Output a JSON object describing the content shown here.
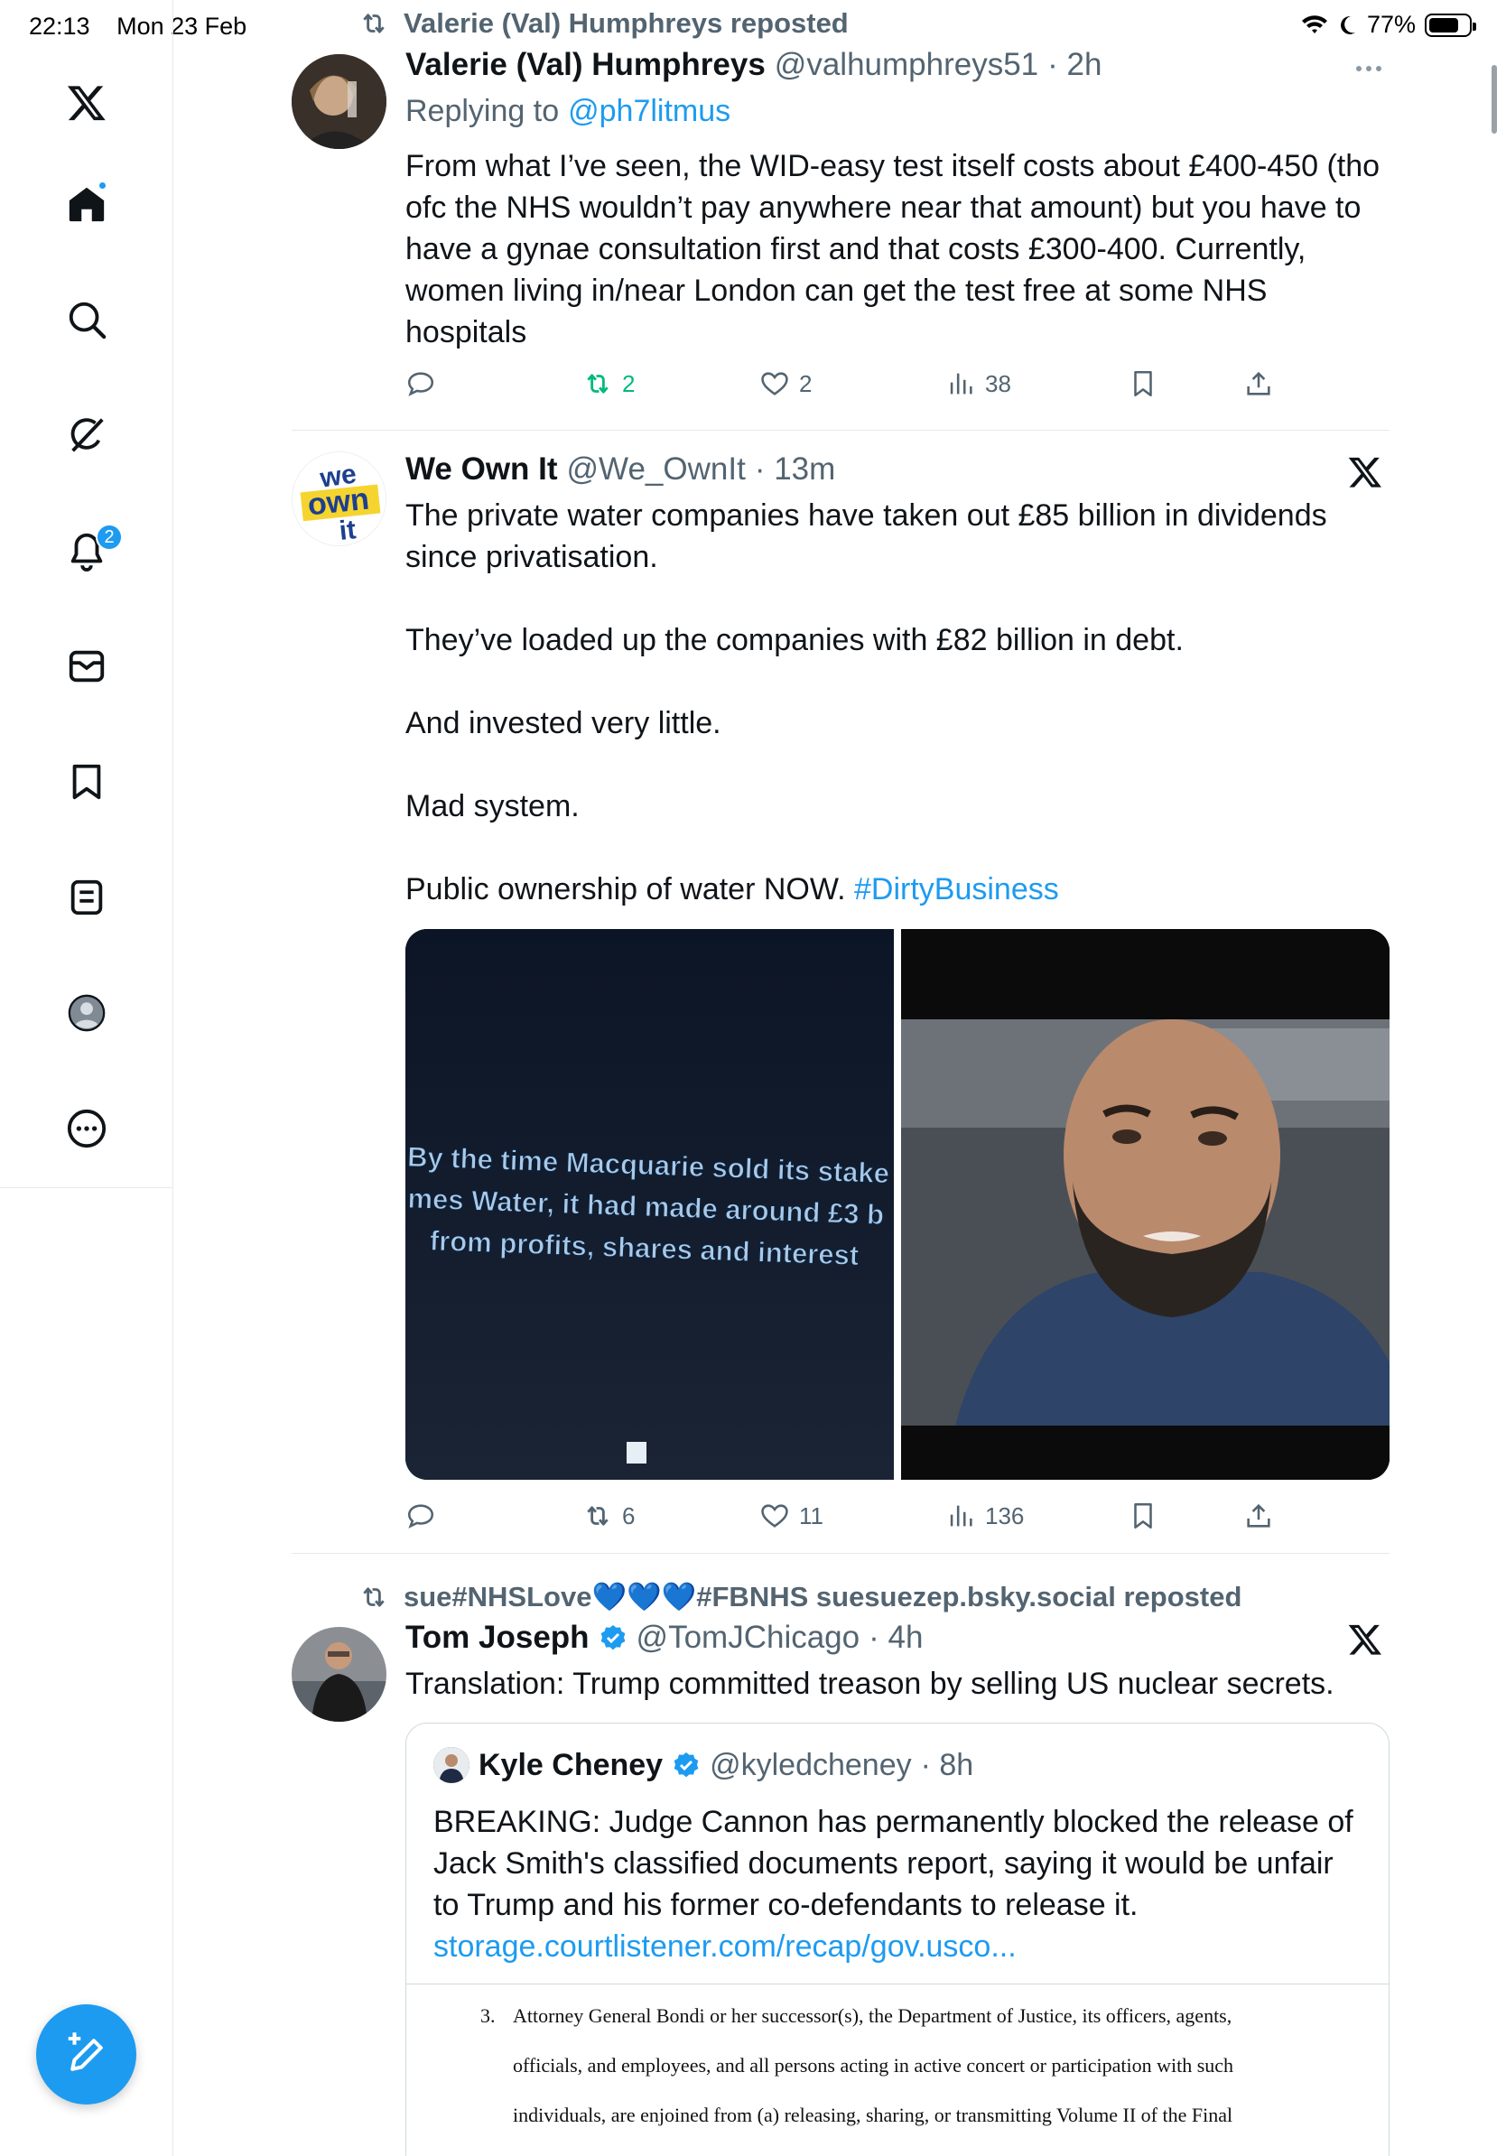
{
  "status_bar": {
    "time": "22:13",
    "date": "Mon 23 Feb",
    "battery": "77%"
  },
  "sidebar": {
    "items": [
      {
        "name": "home",
        "icon": "home-icon"
      },
      {
        "name": "search",
        "icon": "search-icon"
      },
      {
        "name": "grok",
        "icon": "grok-icon"
      },
      {
        "name": "notifications",
        "icon": "bell-icon",
        "badge": "2"
      },
      {
        "name": "messages",
        "icon": "mail-icon"
      },
      {
        "name": "bookmarks",
        "icon": "bookmark-icon"
      },
      {
        "name": "lists",
        "icon": "list-icon"
      },
      {
        "name": "profile",
        "icon": "profile-icon"
      },
      {
        "name": "more",
        "icon": "more-circle-icon"
      }
    ]
  },
  "posts": [
    {
      "repost_label": "Valerie (Val) Humphreys reposted",
      "name": "Valerie (Val) Humphreys",
      "handle": "@valhumphreys51",
      "time": "· 2h",
      "replying_prefix": "Replying to",
      "replying_to": "@ph7litmus",
      "text": "From what I’ve seen, the WID-easy test itself costs about £400-450 (tho ofc the NHS wouldn’t pay anywhere near that amount) but you have to have a gynae consultation first and that costs £300-400. Currently, women living in/near London can get the test free at some NHS hospitals",
      "reposts": "2",
      "likes": "2",
      "views": "38"
    },
    {
      "name": "We Own It",
      "handle": "@We_OwnIt",
      "time": "· 13m",
      "avatar_text": "we own it",
      "text": "The private water companies have taken out £85 billion in dividends since privatisation.\n\nThey’ve loaded up the companies with £82 billion in debt.\n\nAnd invested very little.\n\nMad system.\n\nPublic ownership of water NOW.",
      "hashtag": "#DirtyBusiness",
      "media_caption_lines": [
        "By the time Macquarie sold its stake",
        "mes Water, it had made around £3 b",
        "from profits, shares and interest"
      ],
      "reposts": "6",
      "likes": "11",
      "views": "136"
    },
    {
      "repost_label": "sue#NHSLove💙💙💙#FBNHS suesuezep.bsky.social reposted",
      "name": "Tom Joseph",
      "handle": "@TomJChicago",
      "time": "· 4h",
      "text": "Translation: Trump committed treason by selling US nuclear secrets.",
      "quote": {
        "name": "Kyle Cheney",
        "handle": "@kyledcheney",
        "time": "· 8h",
        "text": "BREAKING: Judge Cannon has permanently blocked the release of Jack Smith's classified documents report, saying it would be unfair to Trump and his former co-defendants to release it.",
        "link": "storage.courtlistener.com/recap/gov.usco...",
        "doc_number": "3.",
        "doc_lines": [
          "Attorney General Bondi or her successor(s), the Department of Justice, its officers, agents,",
          "officials, and employees, and all persons acting in active concert or participation with such",
          "individuals, are enjoined from (a) releasing, sharing, or transmitting Volume II of the Final"
        ]
      }
    }
  ],
  "colors": {
    "accent": "#1d9bf0",
    "repost_green": "#00ba7c",
    "muted": "#536471"
  }
}
